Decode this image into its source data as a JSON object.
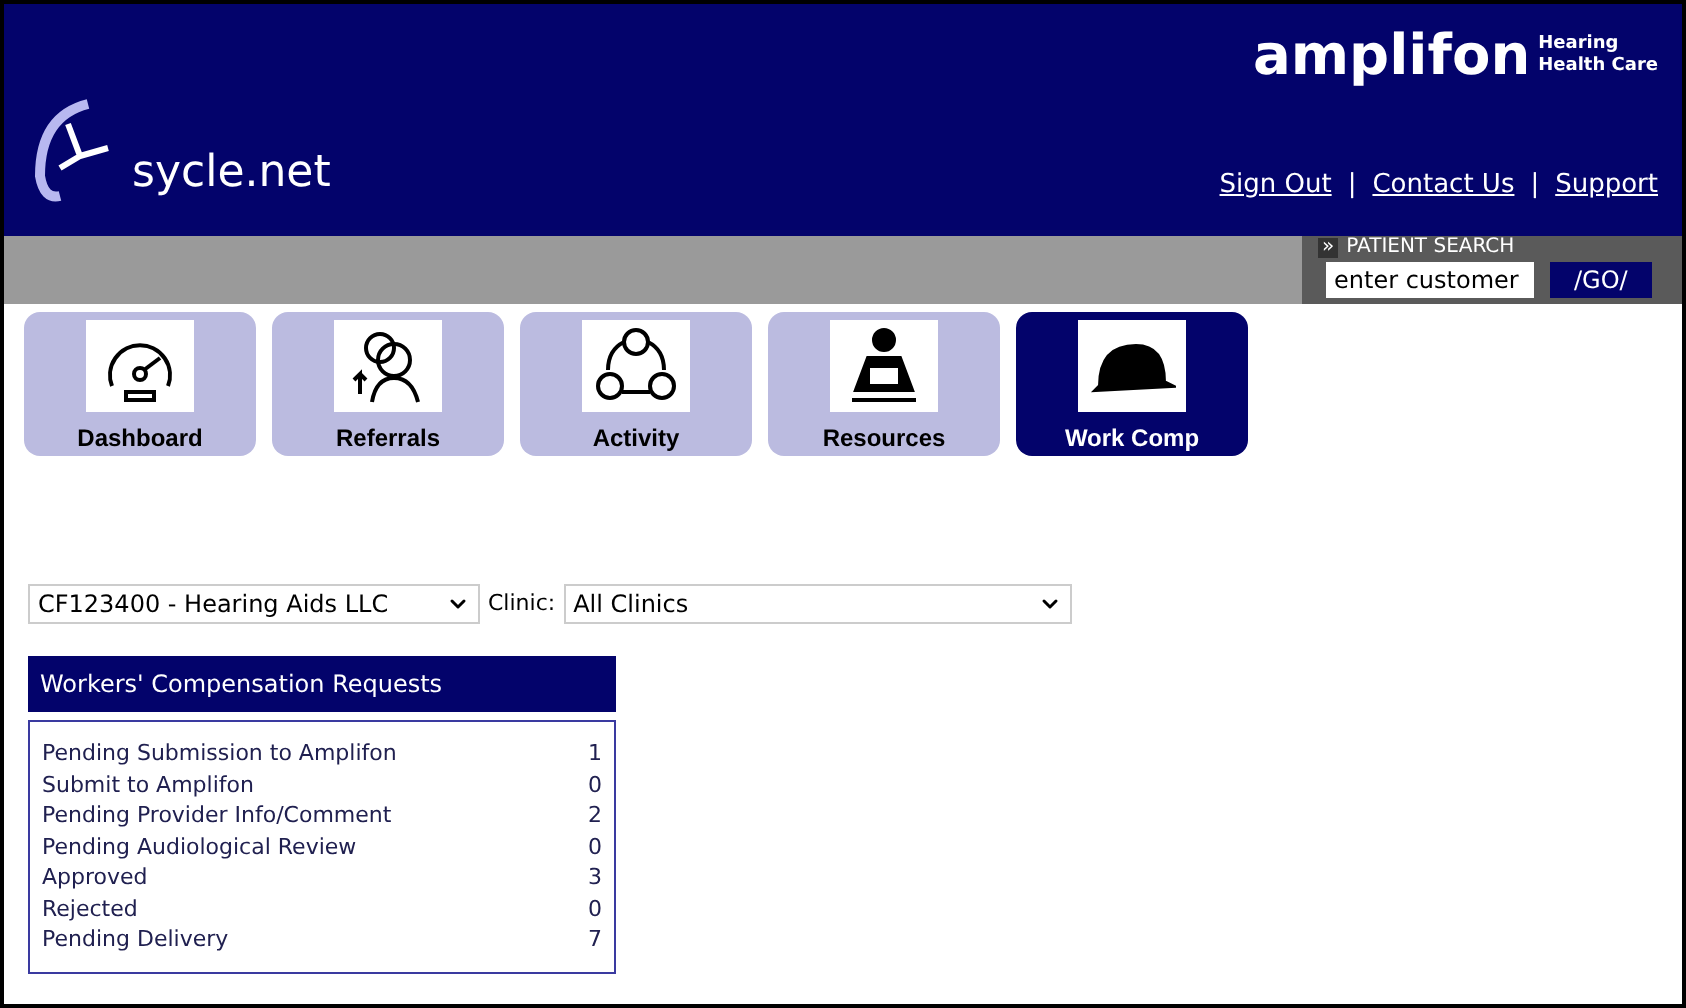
{
  "header": {
    "logo_text": "sycle.net",
    "brand": "amplifon",
    "brand_tagline_1": "Hearing",
    "brand_tagline_2": "Health Care",
    "links": [
      "Sign Out",
      "Contact Us",
      "Support"
    ],
    "separator": "|"
  },
  "patient_search": {
    "marker": "»",
    "label": "PATIENT SEARCH",
    "placeholder": "enter customer",
    "button": "/GO/"
  },
  "tabs": [
    {
      "label": "Dashboard",
      "kind": "gauge",
      "selected": false
    },
    {
      "label": "Referrals",
      "kind": "people",
      "selected": false
    },
    {
      "label": "Activity",
      "kind": "cycle",
      "selected": false
    },
    {
      "label": "Resources",
      "kind": "reader",
      "selected": false
    },
    {
      "label": "Work Comp",
      "kind": "hardhat",
      "selected": true
    }
  ],
  "filters": {
    "account": "CF123400 - Hearing Aids LLC",
    "clinic_label": "Clinic:",
    "clinic": "All Clinics"
  },
  "requests": {
    "title": "Workers' Compensation Requests",
    "rows": [
      {
        "label": "Pending Submission to Amplifon",
        "count": "1"
      },
      {
        "label": "Submit to Amplifon",
        "count": "0"
      },
      {
        "label": "Pending Provider Info/Comment",
        "count": "2"
      },
      {
        "label": "Pending Audiological Review",
        "count": "0"
      },
      {
        "label": "Approved",
        "count": "3"
      },
      {
        "label": "Rejected",
        "count": "0"
      },
      {
        "label": "Pending Delivery",
        "count": "7"
      }
    ]
  }
}
